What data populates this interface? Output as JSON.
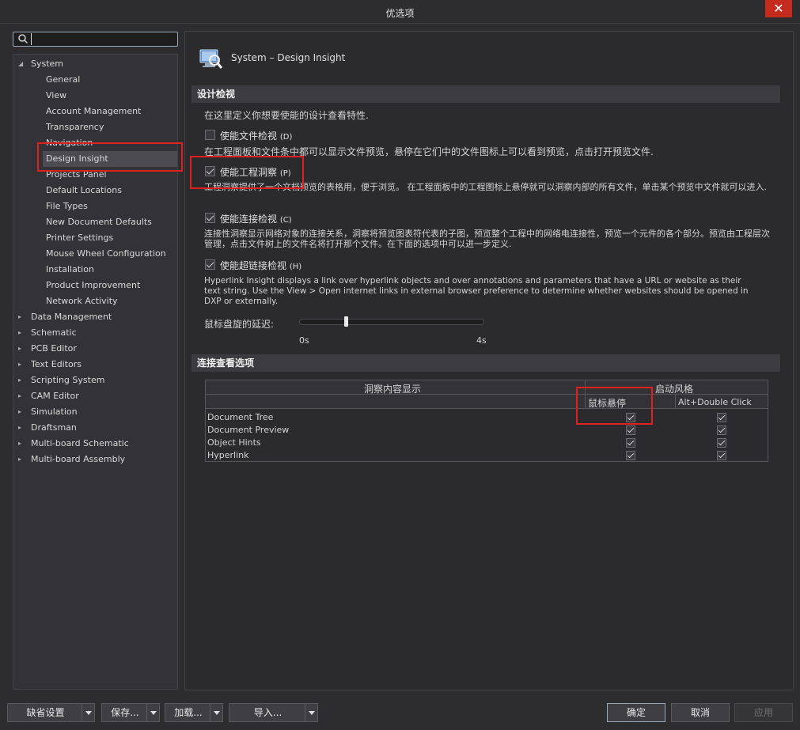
{
  "window": {
    "title": "优选项",
    "close_label": "✕"
  },
  "search": {
    "value": "",
    "placeholder": ""
  },
  "tree": [
    {
      "label": "System",
      "level": 0,
      "arrow": "◢",
      "top": 0
    },
    {
      "label": "General",
      "level": 1
    },
    {
      "label": "View",
      "level": 1
    },
    {
      "label": "Account Management",
      "level": 1
    },
    {
      "label": "Transparency",
      "level": 1
    },
    {
      "label": "Navigation",
      "level": 1
    },
    {
      "label": "Design Insight",
      "level": 1,
      "selected": true
    },
    {
      "label": "Projects Panel",
      "level": 1
    },
    {
      "label": "Default Locations",
      "level": 1
    },
    {
      "label": "File Types",
      "level": 1
    },
    {
      "label": "New Document Defaults",
      "level": 1
    },
    {
      "label": "Printer Settings",
      "level": 1
    },
    {
      "label": "Mouse Wheel Configuration",
      "level": 1
    },
    {
      "label": "Installation",
      "level": 1
    },
    {
      "label": "Product Improvement",
      "level": 1
    },
    {
      "label": "Network Activity",
      "level": 1
    },
    {
      "label": "Data Management",
      "level": 0,
      "arrow": "▸"
    },
    {
      "label": "Schematic",
      "level": 0,
      "arrow": "▸"
    },
    {
      "label": "PCB Editor",
      "level": 0,
      "arrow": "▸"
    },
    {
      "label": "Text Editors",
      "level": 0,
      "arrow": "▸"
    },
    {
      "label": "Scripting System",
      "level": 0,
      "arrow": "▸"
    },
    {
      "label": "CAM Editor",
      "level": 0,
      "arrow": "▸"
    },
    {
      "label": "Simulation",
      "level": 0,
      "arrow": "▸"
    },
    {
      "label": "Draftsman",
      "level": 0,
      "arrow": "▸"
    },
    {
      "label": "Multi-board Schematic",
      "level": 0,
      "arrow": "▸"
    },
    {
      "label": "Multi-board Assembly",
      "level": 0,
      "arrow": "▸"
    }
  ],
  "page": {
    "title": "System – Design Insight",
    "section1": "设计检视",
    "intro": "在这里定义你想要使能的设计查看特性.",
    "opt1": {
      "label": "使能文件检视",
      "accel": "(D)",
      "checked": false,
      "desc": "在工程面板和文件条中都可以显示文件预览，悬停在它们中的文件图标上可以看到预览，点击打开预览文件."
    },
    "opt2": {
      "label": "使能工程洞察",
      "accel": "(P)",
      "checked": true,
      "desc": "工程洞察提供了一个文档预览的表格用，便于浏览。 在工程面板中的工程图标上悬停就可以洞察内部的所有文件，单击某个预览中文件就可以进入."
    },
    "opt3": {
      "label": "使能连接检视",
      "accel": "(C)",
      "checked": true,
      "desc": "连接性洞察显示网络对象的连接关系，洞察将预览图表符代表的子图，预览整个工程中的网络电连接性，预览一个元件的各个部分。预览由工程层次管理，点击文件树上的文件名将打开那个文件。在下面的选项中可以进一步定义."
    },
    "opt4": {
      "label": "使能超链接检视",
      "accel": "(H)",
      "checked": true,
      "desc": "Hyperlink Insight displays a link over hyperlink objects and over annotations and parameters that have a URL or website as their text string. Use the View > Open internet links in external browser preference to determine whether websites should be opened in DXP or externally."
    },
    "delay_label": "鼠标盘旋的延迟:",
    "delay_min": "0s",
    "delay_max": "4s",
    "delay_value": 0.25,
    "section2": "连接查看选项",
    "grid": {
      "col_content": "洞察内容显示",
      "col_style": "启动风格",
      "sub_hover": "鼠标悬停",
      "sub_alt": "Alt+Double Click",
      "rows": [
        {
          "name": "Document Tree",
          "hover": true,
          "alt": true
        },
        {
          "name": "Document Preview",
          "hover": true,
          "alt": true
        },
        {
          "name": "Object Hints",
          "hover": true,
          "alt": true
        },
        {
          "name": "Hyperlink",
          "hover": true,
          "alt": true
        }
      ]
    }
  },
  "footer": {
    "defaults": "缺省设置",
    "save": "保存...",
    "load": "加载...",
    "import": "导入...",
    "ok": "确定",
    "cancel": "取消",
    "apply": "应用"
  },
  "colors": {
    "highlight_box": "#e02020",
    "accent_border": "#9aa7b8"
  }
}
